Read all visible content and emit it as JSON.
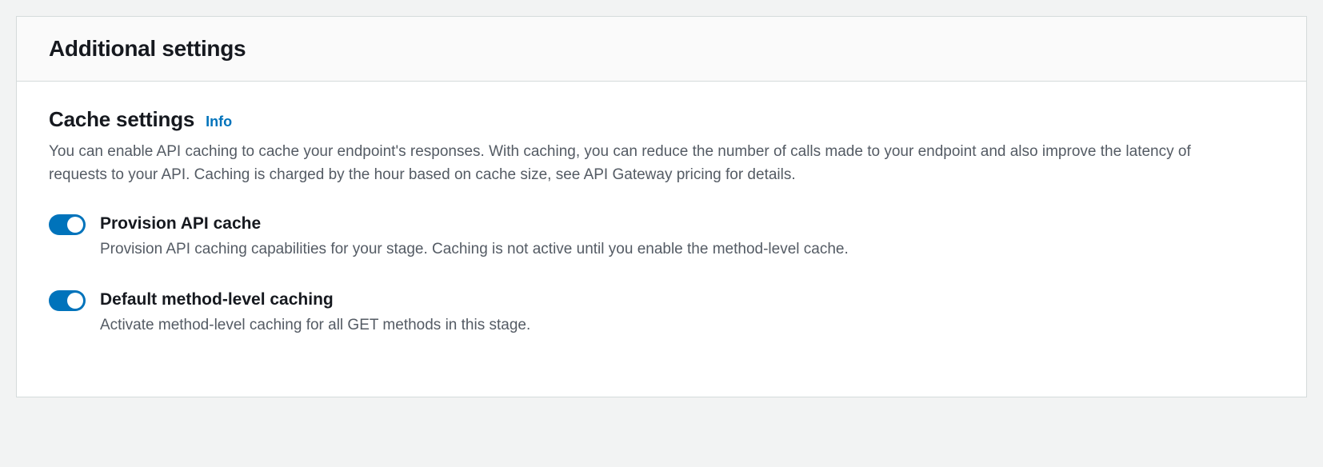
{
  "panel": {
    "title": "Additional settings"
  },
  "cache_section": {
    "title": "Cache settings",
    "info_label": "Info",
    "description": "You can enable API caching to cache your endpoint's responses. With caching, you can reduce the number of calls made to your endpoint and also improve the latency of requests to your API. Caching is charged by the hour based on cache size, see API Gateway pricing for details."
  },
  "toggles": {
    "provision": {
      "label": "Provision API cache",
      "hint": "Provision API caching capabilities for your stage. Caching is not active until you enable the method-level cache.",
      "enabled": true
    },
    "method_level": {
      "label": "Default method-level caching",
      "hint": "Activate method-level caching for all GET methods in this stage.",
      "enabled": true
    }
  }
}
